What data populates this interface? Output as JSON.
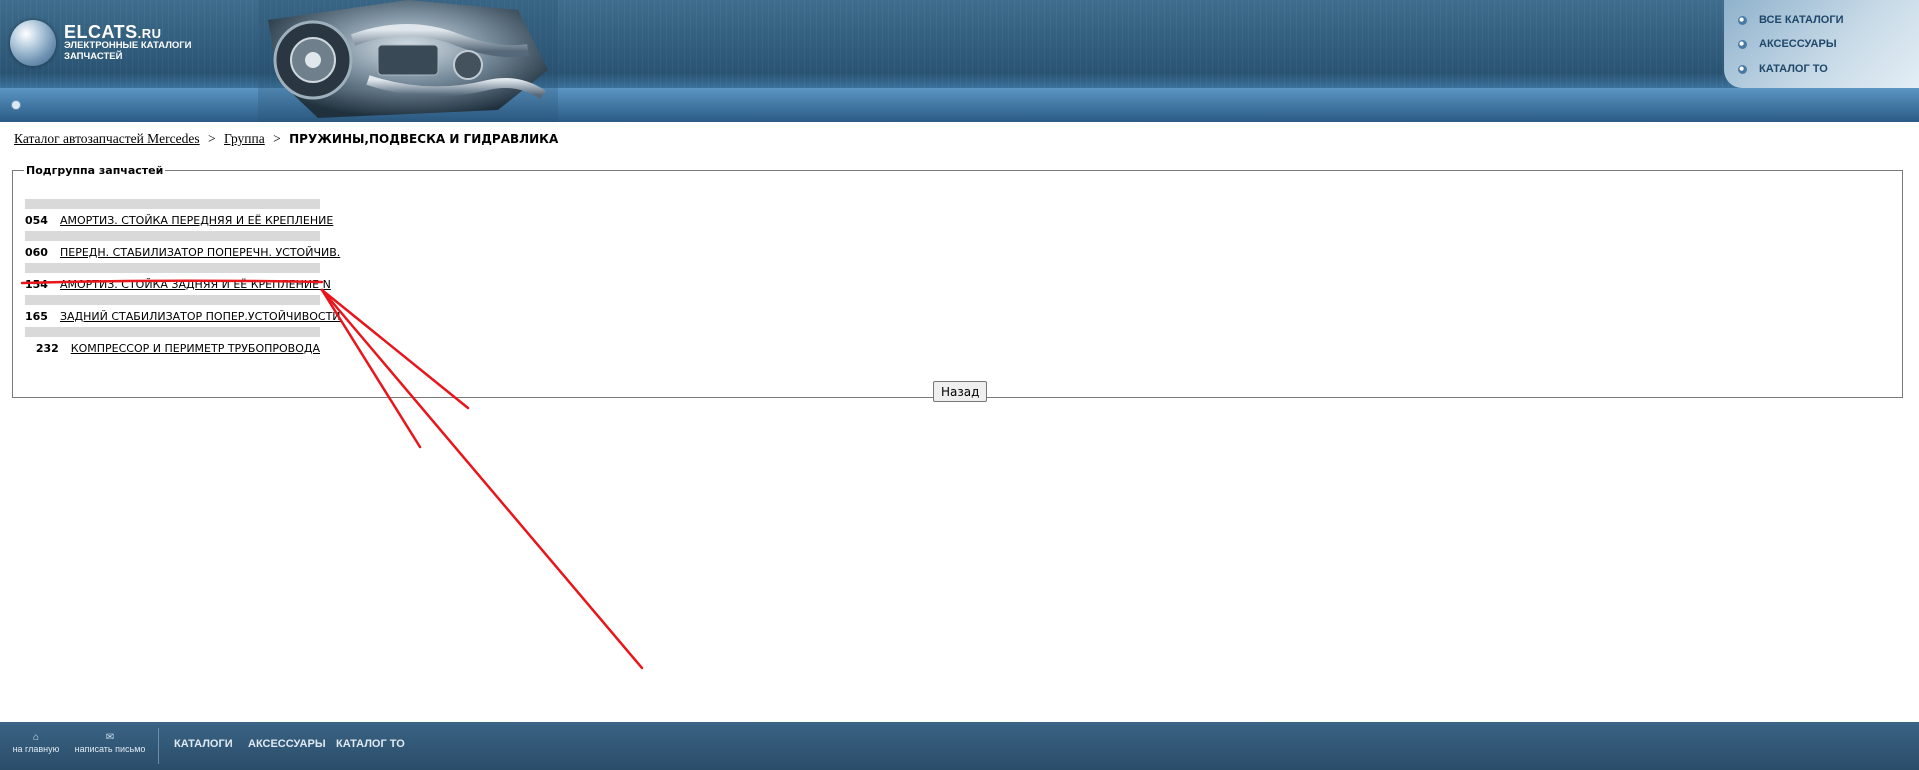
{
  "header": {
    "logo_name": "ELCATS",
    "logo_domain": ".RU",
    "logo_subtitle": "ЭЛЕКТРОННЫЕ КАТАЛОГИ ЗАПЧАСТЕЙ",
    "top_menu": [
      {
        "label": "ВСЕ КАТАЛОГИ"
      },
      {
        "label": "АКСЕССУАРЫ"
      },
      {
        "label": "КАТАЛОГ ТО"
      }
    ]
  },
  "breadcrumb": {
    "catalog_link": "Каталог автозапчастей Mercedes",
    "group_link": "Группа",
    "separator": ">",
    "current": "ПРУЖИНЫ,ПОДВЕСКА И ГИДРАВЛИКА"
  },
  "subgroup": {
    "legend": "Подгруппа запчастей",
    "items": [
      {
        "code": "054",
        "name": "АМОРТИЗ. СТОЙКА ПЕРЕДНЯЯ И ЕЁ КРЕПЛЕНИЕ"
      },
      {
        "code": "060",
        "name": "ПЕРЕДН. СТАБИЛИЗАТОР ПОПЕРЕЧН. УСТОЙЧИВ."
      },
      {
        "code": "154",
        "name": "АМОРТИЗ. СТОЙКА ЗАДНЯЯ И ЕЁ КРЕПЛЕНИЕ N"
      },
      {
        "code": "165",
        "name": "ЗАДНИЙ СТАБИЛИЗАТОР ПОПЕР.УСТОЙЧИВОСТИ"
      },
      {
        "code": "232",
        "name": "КОМПРЕССОР И ПЕРИМЕТР ТРУБОПРОВОДА"
      }
    ],
    "back_label": "Назад"
  },
  "footer": {
    "home_label": "на главную",
    "mail_label": "написать письмо",
    "links": [
      {
        "label": "КАТАЛОГИ"
      },
      {
        "label": "АКСЕССУАРЫ"
      },
      {
        "label": "КАТАЛОГ ТО"
      }
    ]
  },
  "colors": {
    "annotation": "#e8151b",
    "header_dark": "#2f5a79",
    "footer": "#2f5270"
  }
}
